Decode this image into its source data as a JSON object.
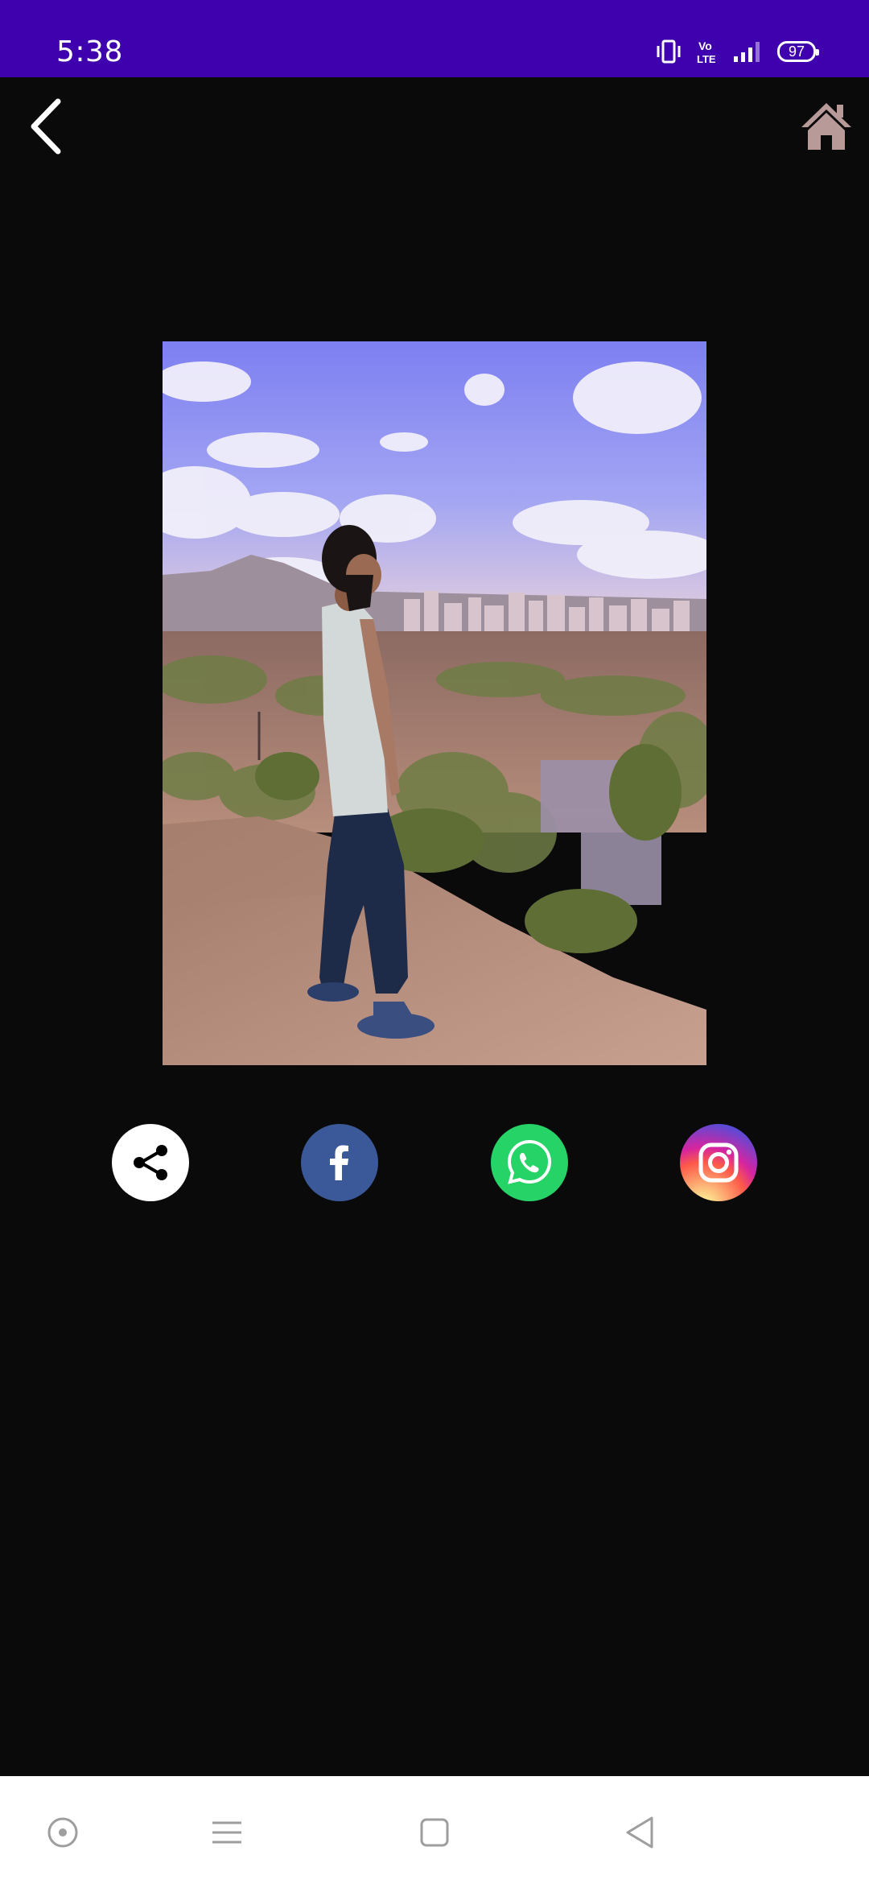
{
  "status_bar": {
    "time": "5:38",
    "battery": "97",
    "icons": [
      "vibrate-icon",
      "volte-icon",
      "signal-icon",
      "battery-icon"
    ],
    "background": "#3f01ad"
  },
  "app_bar": {
    "back_icon": "chevron-left-icon",
    "home_icon": "home-icon",
    "home_color": "#b89a98"
  },
  "photo": {
    "description_icon": "photo-preview"
  },
  "share_buttons": [
    {
      "name": "share",
      "icon": "share-icon",
      "color": "#ffffff"
    },
    {
      "name": "facebook",
      "icon": "facebook-icon",
      "color": "#3b5998"
    },
    {
      "name": "whatsapp",
      "icon": "whatsapp-icon",
      "color": "#25d366"
    },
    {
      "name": "instagram",
      "icon": "instagram-icon",
      "color": "#d6249f"
    }
  ],
  "nav_bar": {
    "items": [
      "assistant-icon",
      "recents-icon",
      "home-icon",
      "back-icon"
    ]
  }
}
